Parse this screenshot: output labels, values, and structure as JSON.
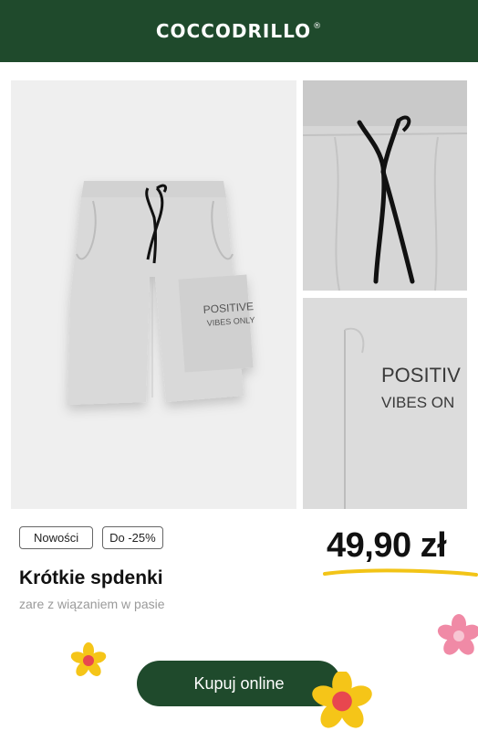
{
  "header": {
    "brand": "COCCODRILLO",
    "registered_mark": "®"
  },
  "gallery": {
    "main_print_line1": "POSITIVE",
    "main_print_line2": "VIBES ONLY",
    "detail_print_line1": "POSITIV",
    "detail_print_line2": "VIBES ON"
  },
  "badges": [
    "Nowości",
    "Do -25%"
  ],
  "product": {
    "title": "Krótkie spdenki",
    "subtitle": "zare z wiązaniem w pasie",
    "price": "49,90 zł"
  },
  "cta": {
    "label": "Kupuj online"
  },
  "colors": {
    "brand_green": "#1f4a2c",
    "price_underline": "#f2c417",
    "flower_yellow": "#f5c518",
    "flower_pink": "#f08aa6",
    "flower_center_red": "#e8474f"
  },
  "icons": [
    "yellow-flower-icon",
    "pink-flower-icon"
  ]
}
